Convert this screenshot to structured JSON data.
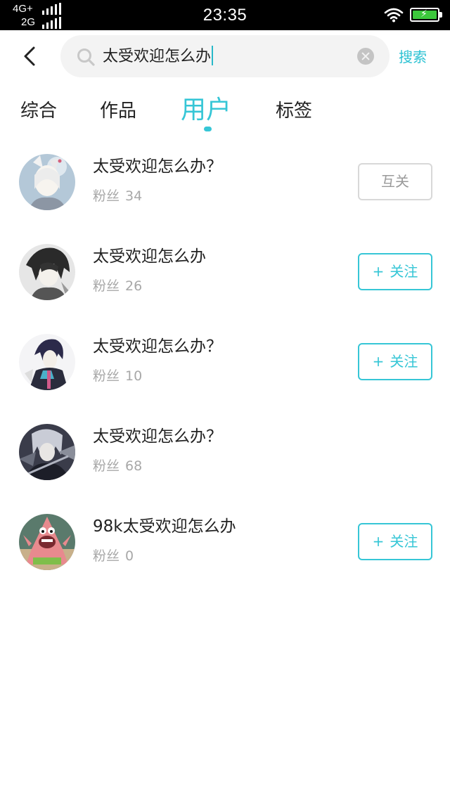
{
  "status_bar": {
    "network_top": "4G+",
    "network_bottom": "2G",
    "time": "23:35"
  },
  "search": {
    "query": "太受欢迎怎么办",
    "button_label": "搜索",
    "icon": "search-icon"
  },
  "tabs": [
    {
      "label": "综合",
      "active": false
    },
    {
      "label": "作品",
      "active": false
    },
    {
      "label": "用户",
      "active": true
    },
    {
      "label": "标签",
      "active": false
    }
  ],
  "colors": {
    "accent": "#36c6d6",
    "text": "#222222",
    "muted": "#a8a8a8",
    "mutual_border": "#d8d8d8"
  },
  "fans_label": "粉丝",
  "users": [
    {
      "name": "太受欢迎怎么办？",
      "fans": "34",
      "action": "互关",
      "action_type": "mutual"
    },
    {
      "name": "太受欢迎怎么办",
      "fans": "26",
      "action": "关注",
      "action_type": "follow"
    },
    {
      "name": "太受欢迎怎么办？",
      "fans": "10",
      "action": "关注",
      "action_type": "follow"
    },
    {
      "name": "太受欢迎怎么办？",
      "fans": "68",
      "action": "",
      "action_type": "none"
    },
    {
      "name": "98k太受欢迎怎么办",
      "fans": "0",
      "action": "关注",
      "action_type": "follow"
    }
  ],
  "follow_plus": "+"
}
